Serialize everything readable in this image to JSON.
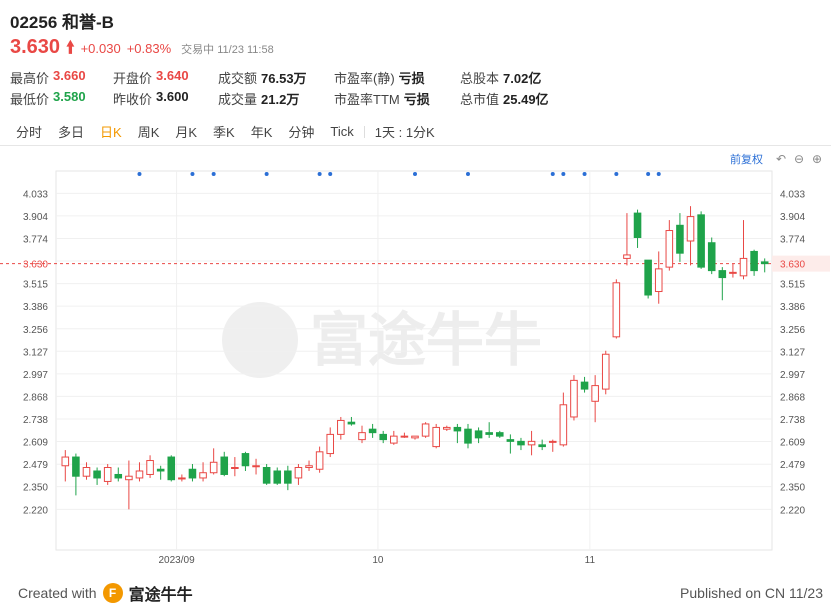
{
  "stock": {
    "name": "02256 和誉-B",
    "price": "3.630",
    "change": "+0.030",
    "change_pct": "+0.83%",
    "status": "交易中 11/23 11:58"
  },
  "stats": {
    "row1": [
      {
        "label": "最高价",
        "value": "3.660"
      },
      {
        "label": "开盘价",
        "value": "3.640"
      },
      {
        "label": "成交额",
        "value": "76.53万"
      },
      {
        "label": "市盈率(静)",
        "value": "亏损"
      },
      {
        "label": "总股本",
        "value": "7.02亿"
      }
    ],
    "row2": [
      {
        "label": "最低价",
        "value": "3.580"
      },
      {
        "label": "昨收价",
        "value": "3.600"
      },
      {
        "label": "成交量",
        "value": "21.2万"
      },
      {
        "label": "市盈率TTM",
        "value": "亏损"
      },
      {
        "label": "总市值",
        "value": "25.49亿"
      }
    ]
  },
  "tabs": [
    "分时",
    "多日",
    "日K",
    "周K",
    "月K",
    "季K",
    "年K",
    "分钟",
    "Tick",
    "1天 : 1分K"
  ],
  "active_tab": "日K",
  "chart_tools": {
    "adjust_label": "前复权"
  },
  "watermark": "富途牛牛",
  "footer": {
    "created_with": "Created with",
    "brand": "富途牛牛",
    "published": "Published on CN 11/23"
  },
  "colors": {
    "up": "#e94845",
    "down": "#1fa34a",
    "accent": "#f39800",
    "marker": "#2b6fd6"
  },
  "chart_data": {
    "type": "candlestick",
    "y_ticks": [
      "4.033",
      "3.904",
      "3.774",
      "3.645",
      "3.515",
      "3.386",
      "3.256",
      "3.127",
      "2.997",
      "2.868",
      "2.738",
      "2.609",
      "2.479",
      "2.350",
      "2.220"
    ],
    "left_ticks": [
      "4.033",
      "3.904",
      "3.774",
      "3.630",
      "3.515",
      "3.386",
      "3.256",
      "3.127",
      "2.997",
      "2.868",
      "2.738",
      "2.609",
      "2.479",
      "2.350",
      "2.220"
    ],
    "right_ticks": [
      "4.033",
      "3.904",
      "3.774",
      "3.630",
      "3.515",
      "3.386",
      "3.256",
      "3.127",
      "2.997",
      "2.868",
      "2.738",
      "2.609",
      "2.479",
      "2.350",
      "2.220"
    ],
    "ylim": [
      2.13,
      4.11
    ],
    "last_price": 3.63,
    "x_labels": [
      {
        "label": "2023/09",
        "index": 11
      },
      {
        "label": "10",
        "index": 30
      },
      {
        "label": "11",
        "index": 50
      }
    ],
    "marker_indices": [
      7,
      12,
      14,
      19,
      24,
      25,
      33,
      38,
      46,
      47,
      49,
      52,
      55,
      56
    ],
    "candles": [
      [
        2.47,
        2.52,
        2.56,
        2.38
      ],
      [
        2.52,
        2.41,
        2.54,
        2.3
      ],
      [
        2.41,
        2.46,
        2.49,
        2.39
      ],
      [
        2.44,
        2.4,
        2.46,
        2.36
      ],
      [
        2.38,
        2.46,
        2.48,
        2.36
      ],
      [
        2.42,
        2.4,
        2.46,
        2.38
      ],
      [
        2.39,
        2.41,
        2.5,
        2.22
      ],
      [
        2.4,
        2.44,
        2.49,
        2.38
      ],
      [
        2.42,
        2.5,
        2.53,
        2.4
      ],
      [
        2.45,
        2.44,
        2.47,
        2.39
      ],
      [
        2.52,
        2.39,
        2.53,
        2.38
      ],
      [
        2.4,
        2.4,
        2.42,
        2.38
      ],
      [
        2.45,
        2.4,
        2.48,
        2.38
      ],
      [
        2.4,
        2.43,
        2.49,
        2.38
      ],
      [
        2.43,
        2.49,
        2.57,
        2.42
      ],
      [
        2.52,
        2.42,
        2.55,
        2.41
      ],
      [
        2.46,
        2.46,
        2.52,
        2.41
      ],
      [
        2.54,
        2.47,
        2.55,
        2.44
      ],
      [
        2.47,
        2.47,
        2.51,
        2.42
      ],
      [
        2.46,
        2.37,
        2.48,
        2.36
      ],
      [
        2.44,
        2.37,
        2.46,
        2.36
      ],
      [
        2.44,
        2.37,
        2.47,
        2.33
      ],
      [
        2.4,
        2.46,
        2.48,
        2.36
      ],
      [
        2.46,
        2.47,
        2.5,
        2.44
      ],
      [
        2.45,
        2.55,
        2.58,
        2.43
      ],
      [
        2.54,
        2.65,
        2.69,
        2.52
      ],
      [
        2.65,
        2.73,
        2.75,
        2.62
      ],
      [
        2.72,
        2.71,
        2.75,
        2.7
      ],
      [
        2.62,
        2.66,
        2.7,
        2.6
      ],
      [
        2.68,
        2.66,
        2.71,
        2.63
      ],
      [
        2.65,
        2.62,
        2.67,
        2.6
      ],
      [
        2.6,
        2.64,
        2.67,
        2.59
      ],
      [
        2.64,
        2.64,
        2.66,
        2.63
      ],
      [
        2.63,
        2.64,
        2.64,
        2.62
      ],
      [
        2.64,
        2.71,
        2.72,
        2.63
      ],
      [
        2.58,
        2.69,
        2.71,
        2.57
      ],
      [
        2.68,
        2.69,
        2.7,
        2.67
      ],
      [
        2.69,
        2.67,
        2.71,
        2.6
      ],
      [
        2.68,
        2.6,
        2.71,
        2.57
      ],
      [
        2.67,
        2.63,
        2.69,
        2.6
      ],
      [
        2.66,
        2.65,
        2.72,
        2.63
      ],
      [
        2.66,
        2.64,
        2.67,
        2.63
      ],
      [
        2.62,
        2.61,
        2.65,
        2.54
      ],
      [
        2.61,
        2.59,
        2.63,
        2.56
      ],
      [
        2.59,
        2.61,
        2.67,
        2.53
      ],
      [
        2.59,
        2.58,
        2.62,
        2.56
      ],
      [
        2.61,
        2.61,
        2.62,
        2.55
      ],
      [
        2.59,
        2.82,
        2.89,
        2.58
      ],
      [
        2.75,
        2.96,
        2.99,
        2.73
      ],
      [
        2.95,
        2.91,
        2.98,
        2.89
      ],
      [
        2.84,
        2.93,
        2.99,
        2.72
      ],
      [
        2.91,
        3.11,
        3.13,
        2.88
      ],
      [
        3.21,
        3.52,
        3.54,
        3.2
      ],
      [
        3.66,
        3.68,
        3.92,
        3.62
      ],
      [
        3.92,
        3.78,
        3.94,
        3.72
      ],
      [
        3.65,
        3.45,
        3.65,
        3.43
      ],
      [
        3.47,
        3.6,
        3.7,
        3.4
      ],
      [
        3.61,
        3.82,
        3.88,
        3.59
      ],
      [
        3.85,
        3.69,
        3.92,
        3.64
      ],
      [
        3.76,
        3.9,
        3.96,
        3.62
      ],
      [
        3.91,
        3.61,
        3.93,
        3.6
      ],
      [
        3.75,
        3.59,
        3.78,
        3.57
      ],
      [
        3.59,
        3.55,
        3.61,
        3.42
      ],
      [
        3.58,
        3.58,
        3.63,
        3.55
      ],
      [
        3.56,
        3.66,
        3.88,
        3.54
      ],
      [
        3.7,
        3.59,
        3.71,
        3.56
      ],
      [
        3.64,
        3.63,
        3.66,
        3.58
      ]
    ]
  }
}
